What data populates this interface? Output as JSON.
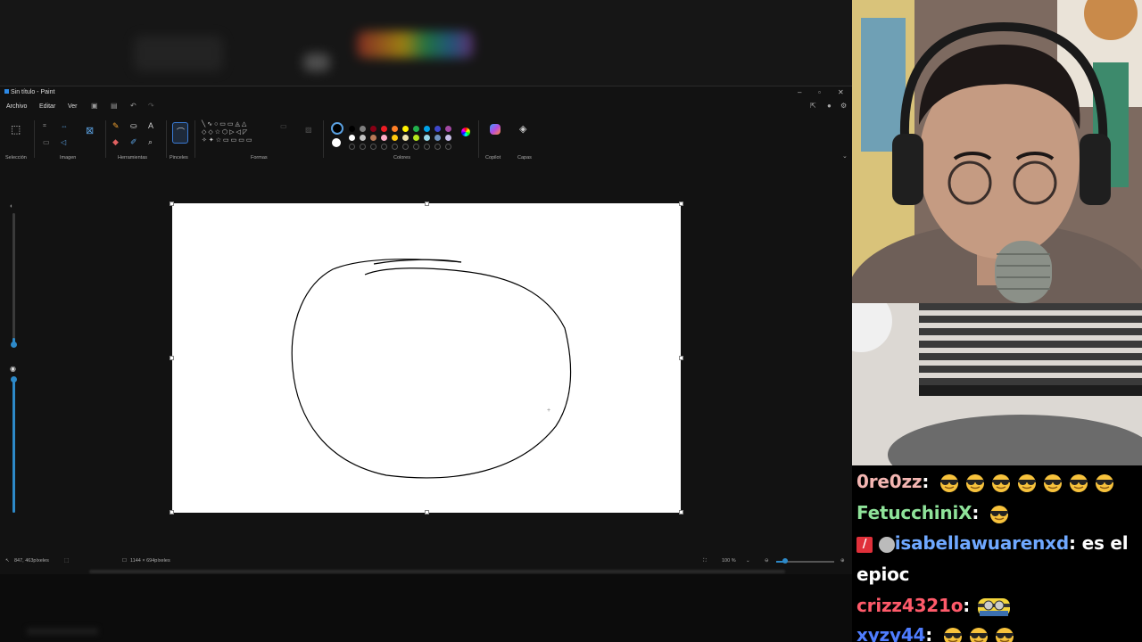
{
  "paint": {
    "window_title": "Sin título - Paint",
    "menu": [
      "Archivo",
      "Editar",
      "Ver"
    ],
    "groups": {
      "seleccion": "Selección",
      "imagen": "Imagen",
      "herramientas": "Herramientas",
      "pinceles": "Pinceles",
      "formas": "Formas",
      "colores": "Colores",
      "copilot": "Copilot",
      "capas": "Capas"
    },
    "colors": {
      "primary": "#000000",
      "secondary": "#ffffff",
      "palette_row1": [
        "#000000",
        "#7f7f7f",
        "#880015",
        "#ed1c24",
        "#ff7f27",
        "#fff200",
        "#22b14c",
        "#00a2e8",
        "#3f48cc",
        "#a349a4"
      ],
      "palette_row2": [
        "#ffffff",
        "#c3c3c3",
        "#b97a57",
        "#ffaec9",
        "#ffc90e",
        "#efe4b0",
        "#b5e61d",
        "#99d9ea",
        "#7092be",
        "#c8bfe7"
      ]
    },
    "status": {
      "cursor_position": "847, 463píxeles",
      "canvas_size": "1144 × 694píxeles",
      "zoom": "100 %"
    }
  },
  "chat": [
    {
      "user": "0re0zz",
      "user_color": "#f4b6b2",
      "message": "",
      "emotes": 7
    },
    {
      "user": "FetucchiniX",
      "user_color": "#8fe39a",
      "message": "",
      "emotes": 1
    },
    {
      "user": "isabellawuarenxd",
      "user_color": "#6fa8ff",
      "message": "es el",
      "emotes": 0,
      "badges": 2
    },
    {
      "user": "",
      "user_color": "#ffffff",
      "message": "epioc",
      "emotes": 0
    },
    {
      "user": "crizz4321o",
      "user_color": "#ff5a6a",
      "message": "",
      "emotes": 0,
      "custom_emote": true
    },
    {
      "user": "xyzy44",
      "user_color": "#4f7dff",
      "message": "",
      "emotes": 3
    }
  ]
}
